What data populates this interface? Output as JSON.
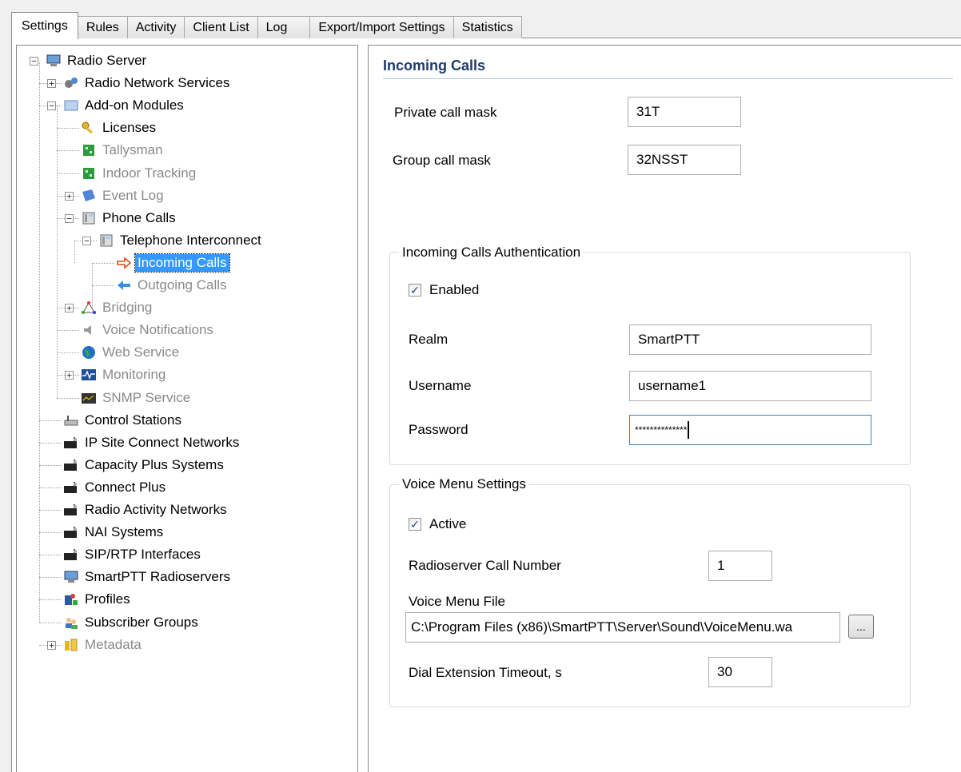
{
  "tabs": [
    "Settings",
    "Rules",
    "Activity",
    "Client List",
    "Log",
    "Export/Import Settings",
    "Statistics"
  ],
  "active_tab": "Settings",
  "tree": [
    {
      "label": "Radio Server",
      "icon": "computer-icon",
      "expander": "−"
    },
    {
      "label": "Radio Network Services",
      "icon": "network-services-icon",
      "expander": "+"
    },
    {
      "label": "Add-on Modules",
      "icon": "modules-icon",
      "expander": "−"
    },
    {
      "label": "Licenses",
      "icon": "key-icon"
    },
    {
      "label": "Tallysman",
      "icon": "module-green-icon",
      "disabled": true
    },
    {
      "label": "Indoor Tracking",
      "icon": "module-green-icon",
      "disabled": true
    },
    {
      "label": "Event Log",
      "icon": "event-log-icon",
      "expander": "+",
      "disabled": true
    },
    {
      "label": "Phone Calls",
      "icon": "phone-icon",
      "expander": "−"
    },
    {
      "label": "Telephone Interconnect",
      "icon": "phone-icon",
      "expander": "−"
    },
    {
      "label": "Incoming Calls",
      "icon": "arrow-right-icon",
      "selected": true
    },
    {
      "label": "Outgoing Calls",
      "icon": "arrow-left-icon",
      "disabled": true
    },
    {
      "label": "Bridging",
      "icon": "bridging-icon",
      "expander": "+",
      "disabled": true
    },
    {
      "label": "Voice Notifications",
      "icon": "speaker-icon",
      "disabled": true
    },
    {
      "label": "Web Service",
      "icon": "globe-icon",
      "disabled": true
    },
    {
      "label": "Monitoring",
      "icon": "monitoring-icon",
      "expander": "+",
      "disabled": true
    },
    {
      "label": "SNMP Service",
      "icon": "snmp-icon",
      "disabled": true
    },
    {
      "label": "Control Stations",
      "icon": "control-station-icon"
    },
    {
      "label": "IP Site Connect Networks",
      "icon": "repeater-icon"
    },
    {
      "label": "Capacity Plus Systems",
      "icon": "repeater-icon"
    },
    {
      "label": "Connect Plus",
      "icon": "repeater-icon"
    },
    {
      "label": "Radio Activity Networks",
      "icon": "repeater-icon"
    },
    {
      "label": "NAI Systems",
      "icon": "repeater-icon"
    },
    {
      "label": "SIP/RTP Interfaces",
      "icon": "repeater-icon"
    },
    {
      "label": "SmartPTT Radioservers",
      "icon": "computer-icon"
    },
    {
      "label": "Profiles",
      "icon": "profiles-icon"
    },
    {
      "label": "Subscriber Groups",
      "icon": "subscriber-groups-icon"
    },
    {
      "label": "Metadata",
      "icon": "metadata-icon",
      "expander": "+",
      "disabled": true
    }
  ],
  "panel": {
    "title": "Incoming Calls",
    "private_call_mask_label": "Private call mask",
    "private_call_mask_value": "31T",
    "group_call_mask_label": "Group call mask",
    "group_call_mask_value": "32NSST",
    "auth": {
      "title": "Incoming Calls Authentication",
      "enabled_label": "Enabled",
      "enabled_checked": true,
      "realm_label": "Realm",
      "realm_value": "SmartPTT",
      "username_label": "Username",
      "username_value": "username1",
      "password_label": "Password",
      "password_value": "**************"
    },
    "voice_menu": {
      "title": "Voice Menu Settings",
      "active_label": "Active",
      "active_checked": true,
      "call_number_label": "Radioserver Call Number",
      "call_number_value": "1",
      "file_label": "Voice Menu File",
      "file_value": "C:\\Program Files (x86)\\SmartPTT\\Server\\Sound\\VoiceMenu.wa",
      "browse_label": "...",
      "timeout_label": "Dial Extension Timeout, s",
      "timeout_value": "30"
    }
  },
  "colors": {
    "selection": "#3399ff",
    "section_title": "#1e3a6e",
    "disabled_text": "#8a8a8a"
  }
}
